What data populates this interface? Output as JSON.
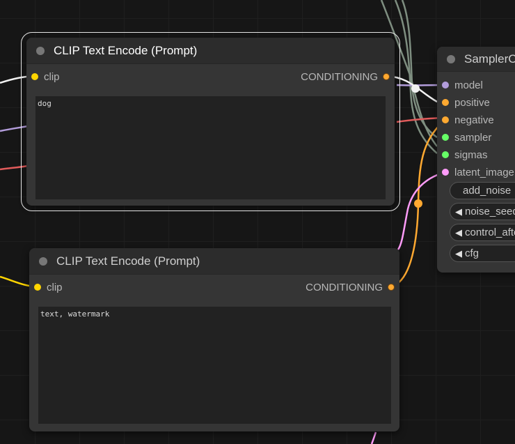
{
  "nodes": {
    "positive_encoder": {
      "title": "CLIP Text Encode (Prompt)",
      "input_label": "clip",
      "output_label": "CONDITIONING",
      "text": "dog"
    },
    "negative_encoder": {
      "title": "CLIP Text Encode (Prompt)",
      "input_label": "clip",
      "output_label": "CONDITIONING",
      "text": "text, watermark"
    },
    "sampler": {
      "title": "SamplerC",
      "inputs": [
        "model",
        "positive",
        "negative",
        "sampler",
        "sigmas",
        "latent_image"
      ],
      "widgets": [
        "add_noise",
        "noise_seed",
        "control_after",
        "cfg"
      ]
    }
  },
  "colors": {
    "clip": "#ffd500",
    "conditioning": "#ffa931",
    "model": "#b39ddb",
    "sampler": "#66ff66",
    "sigmas": "#66ff66",
    "latent": "#ff9cf9",
    "wire_gray": "#7e8e80",
    "wire_red": "#e15b5b"
  }
}
